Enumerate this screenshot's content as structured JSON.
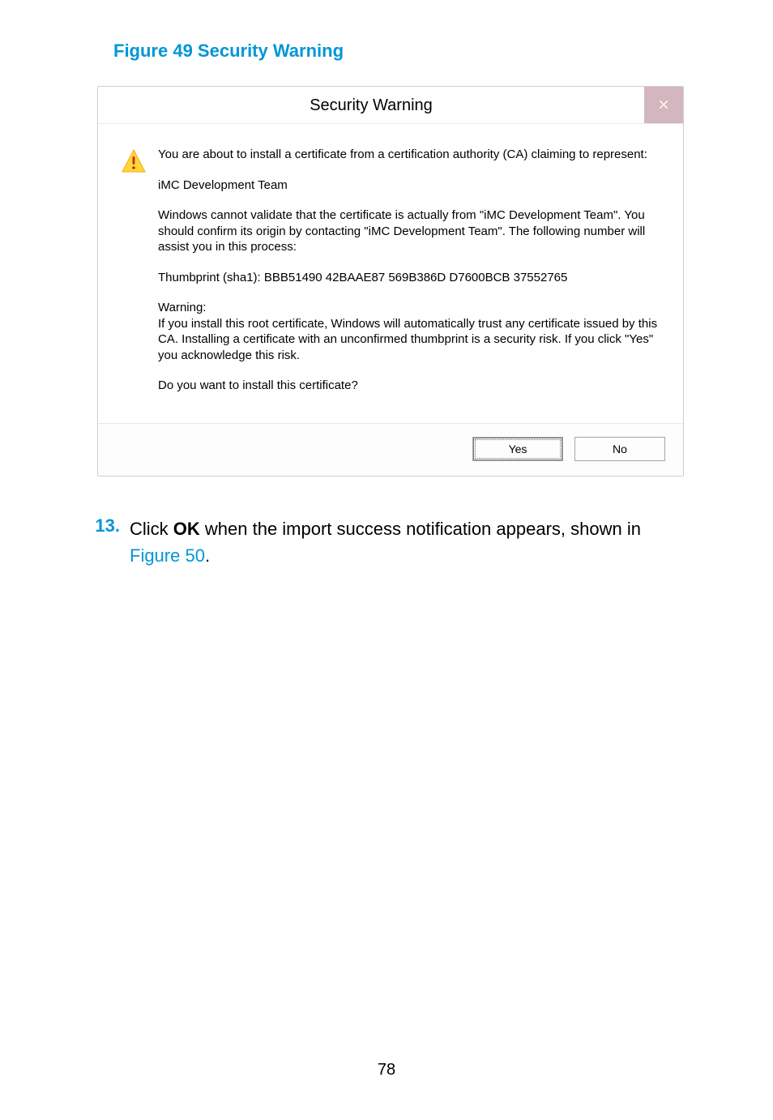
{
  "figure_caption": "Figure 49 Security Warning",
  "dialog": {
    "title": "Security Warning",
    "paragraphs": {
      "p1": "You are about to install a certificate from a certification authority (CA) claiming to represent:",
      "p2": "iMC Development Team",
      "p3": "Windows cannot validate that the certificate is actually from \"iMC Development Team\". You should confirm its origin by contacting \"iMC Development Team\". The following number will assist you in this process:",
      "p4": "Thumbprint (sha1): BBB51490 42BAAE87 569B386D D7600BCB 37552765",
      "p5": "Warning:\nIf you install this root certificate, Windows will automatically trust any certificate issued by this CA. Installing a certificate with an unconfirmed thumbprint is a security risk. If you click \"Yes\" you acknowledge this risk.",
      "p6": "Do you want to install this certificate?"
    },
    "buttons": {
      "yes": "Yes",
      "no": "No"
    }
  },
  "step": {
    "number": "13.",
    "pre": "Click ",
    "bold": "OK",
    "mid": " when the import success notification appears, shown in ",
    "link": "Figure 50",
    "post": "."
  },
  "page_number": "78"
}
